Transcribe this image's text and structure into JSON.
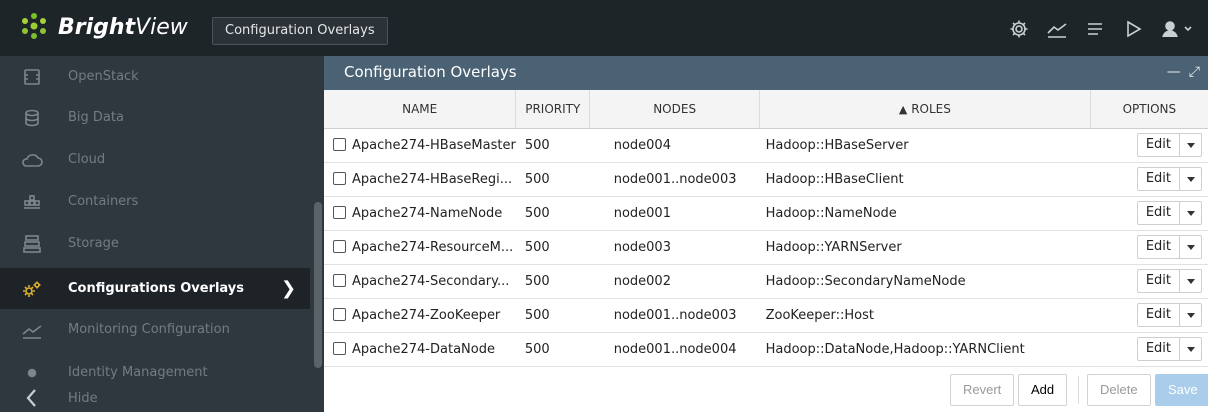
{
  "header": {
    "brand_bold": "Bright",
    "brand_light": "View",
    "context_tab": "Configuration Overlays",
    "icons": [
      "settings-gear-icon",
      "monitoring-chart-icon",
      "list-menu-icon",
      "play-icon",
      "user-icon"
    ]
  },
  "sidebar": {
    "items": [
      {
        "label": "OpenStack",
        "icon": "openstack-icon"
      },
      {
        "label": "Big Data",
        "icon": "database-icon"
      },
      {
        "label": "Cloud",
        "icon": "cloud-icon"
      },
      {
        "label": "Containers",
        "icon": "containers-icon"
      },
      {
        "label": "Storage",
        "icon": "storage-icon"
      },
      {
        "label": "Configurations Overlays",
        "icon": "gears-icon",
        "active": true
      },
      {
        "label": "Monitoring Configuration",
        "icon": "monitoring-icon"
      },
      {
        "label": "Identity Management",
        "icon": "identity-icon"
      }
    ],
    "hide_label": "Hide"
  },
  "panel": {
    "title": "Configuration Overlays",
    "columns": {
      "name": "NAME",
      "priority": "PRIORITY",
      "nodes": "NODES",
      "roles": "ROLES",
      "roles_sort": "▲",
      "options": "OPTIONS"
    },
    "rows": [
      {
        "name": "Apache274-HBaseMaster",
        "priority": "500",
        "nodes": "node004",
        "roles": "Hadoop::HBaseServer",
        "edit": "Edit"
      },
      {
        "name": "Apache274-HBaseRegi...",
        "priority": "500",
        "nodes": "node001..node003",
        "roles": "Hadoop::HBaseClient",
        "edit": "Edit"
      },
      {
        "name": "Apache274-NameNode",
        "priority": "500",
        "nodes": "node001",
        "roles": "Hadoop::NameNode",
        "edit": "Edit"
      },
      {
        "name": "Apache274-ResourceM...",
        "priority": "500",
        "nodes": "node003",
        "roles": "Hadoop::YARNServer",
        "edit": "Edit"
      },
      {
        "name": "Apache274-Secondary...",
        "priority": "500",
        "nodes": "node002",
        "roles": "Hadoop::SecondaryNameNode",
        "edit": "Edit"
      },
      {
        "name": "Apache274-ZooKeeper",
        "priority": "500",
        "nodes": "node001..node003",
        "roles": "ZooKeeper::Host",
        "edit": "Edit"
      },
      {
        "name": "Apache274-DataNode",
        "priority": "500",
        "nodes": "node001..node004",
        "roles": "Hadoop::DataNode,Hadoop::YARNClient",
        "edit": "Edit"
      }
    ],
    "footer": {
      "revert": "Revert",
      "add": "Add",
      "delete": "Delete",
      "save": "Save"
    }
  },
  "colors": {
    "topbar": "#1e2529",
    "sidebar": "#2f383e",
    "panel_header": "#4a6274",
    "active_icon": "#e0b12e",
    "save_button": "#a9cdea"
  }
}
